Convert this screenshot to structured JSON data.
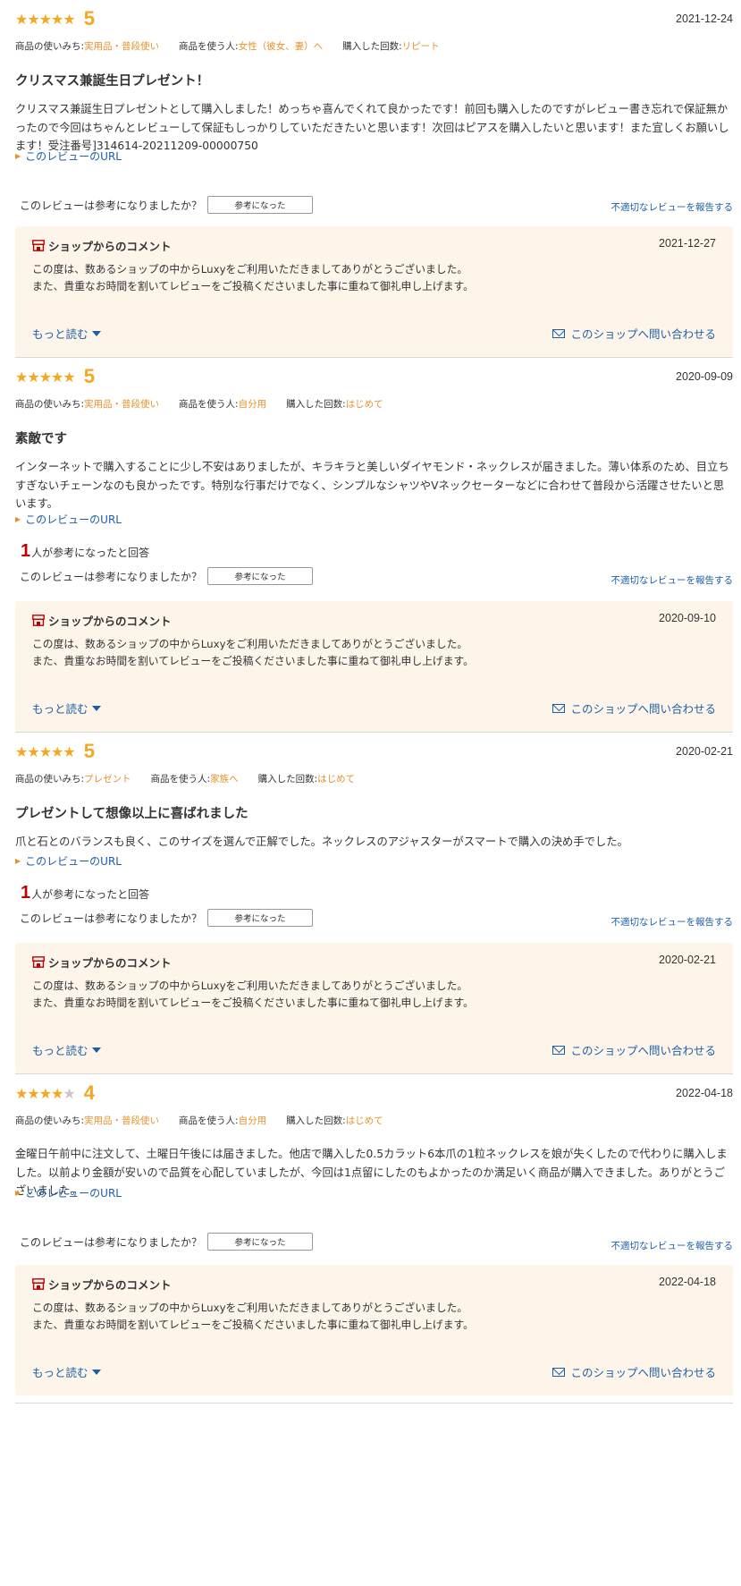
{
  "labels": {
    "usage": "商品の使いみち:",
    "user": "商品を使う人:",
    "count": "購入した回数:",
    "url": "このレビューのURL",
    "helped_suffix": "人が参考になったと回答",
    "question": "このレビューは参考になりましたか？",
    "helpful_button": "参考になった",
    "report": "不適切なレビューを報告する",
    "shop_comment": "ショップからのコメント",
    "more": "もっと読む",
    "contact": "このショップへ問い合わせる"
  },
  "colors": {
    "star": "#f5a623",
    "accent": "#e8912b",
    "link": "#1d5ea8",
    "shop_bg": "#fdf5e9",
    "helped_num": "#bf0000"
  },
  "shop_reply_lines": [
    "この度は、数あるショップの中からLuxyをご利用いただきましてありがとうございました。",
    "また、貴重なお時間を割いてレビューをご投稿くださいました事に重ねて御礼申し上げます。"
  ],
  "reviews": [
    {
      "stars": 5,
      "score": "5",
      "date": "2021-12-24",
      "usage": "実用品・普段使い",
      "user": "女性（彼女、妻）へ",
      "count": "リピート",
      "title": "クリスマス兼誕生日プレゼント！",
      "body": "クリスマス兼誕生日プレゼントとして購入しました！めっちゃ喜んでくれて良かったです！前回も購入したのですがレビュー書き忘れで保証無かったので今回はちゃんとレビューして保証もしっかりしていただきたいと思います！次回はピアスを購入したいと思います！また宜しくお願いします！受注番号]314614-20211209-00000750",
      "helped": "",
      "shop_date": "2021-12-27"
    },
    {
      "stars": 5,
      "score": "5",
      "date": "2020-09-09",
      "usage": "実用品・普段使い",
      "user": "自分用",
      "count": "はじめて",
      "title": "素敵です",
      "body": "インターネットで購入することに少し不安はありましたが、キラキラと美しいダイヤモンド・ネックレスが届きました。薄い体系のため、目立ちすぎないチェーンなのも良かったです。特別な行事だけでなく、シンプルなシャツやVネックセーターなどに合わせて普段から活躍させたいと思います。",
      "helped": "1",
      "shop_date": "2020-09-10"
    },
    {
      "stars": 5,
      "score": "5",
      "date": "2020-02-21",
      "usage": "プレゼント",
      "user": "家族へ",
      "count": "はじめて",
      "title": "プレゼントして想像以上に喜ばれました",
      "body": "爪と石とのバランスも良く、このサイズを選んで正解でした。ネックレスのアジャスターがスマートで購入の決め手でした。",
      "helped": "1",
      "shop_date": "2020-02-21"
    },
    {
      "stars": 4,
      "score": "4",
      "date": "2022-04-18",
      "usage": "実用品・普段使い",
      "user": "自分用",
      "count": "はじめて",
      "title": "",
      "body": "金曜日午前中に注文して、土曜日午後には届きました。他店で購入した0.5カラット6本爪の1粒ネックレスを娘が失くしたので代わりに購入しました。以前より金額が安いので品質を心配していましたが、今回は1点留にしたのもよかったのか満足いく商品が購入できました。ありがとうございました。",
      "helped": "",
      "shop_date": "2022-04-18"
    }
  ]
}
